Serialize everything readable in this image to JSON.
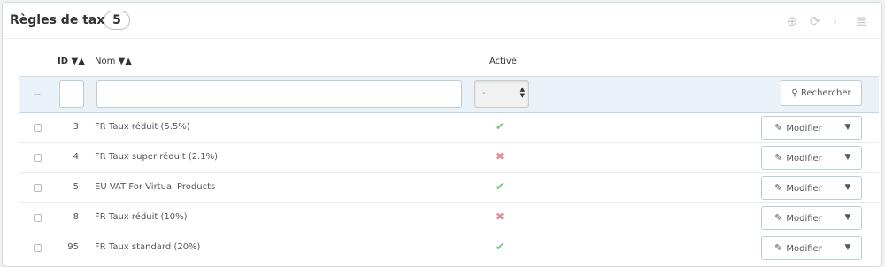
{
  "panel": {
    "title": "Règles de taxes",
    "count": "5",
    "toolbar_icons": [
      "add-icon",
      "refresh-icon",
      "sql-icon",
      "database-icon"
    ]
  },
  "table": {
    "headers": {
      "id": "ID",
      "name": "Nom",
      "active": "Activé"
    },
    "filter": {
      "dash": "--",
      "id_value": "",
      "name_value": "",
      "active_selected": "-",
      "search_label": "Rechercher"
    },
    "rows": [
      {
        "id": "3",
        "name": "FR Taux réduit (5.5%)",
        "active": true
      },
      {
        "id": "4",
        "name": "FR Taux super réduit (2.1%)",
        "active": false
      },
      {
        "id": "5",
        "name": "EU VAT For Virtual Products",
        "active": true
      },
      {
        "id": "8",
        "name": "FR Taux réduit (10%)",
        "active": false
      },
      {
        "id": "95",
        "name": "FR Taux standard (20%)",
        "active": true
      }
    ],
    "edit_label": "Modifier"
  },
  "colors": {
    "accent": "#25b9d7",
    "enabled": "#72c279",
    "disabled": "#e08f95"
  }
}
